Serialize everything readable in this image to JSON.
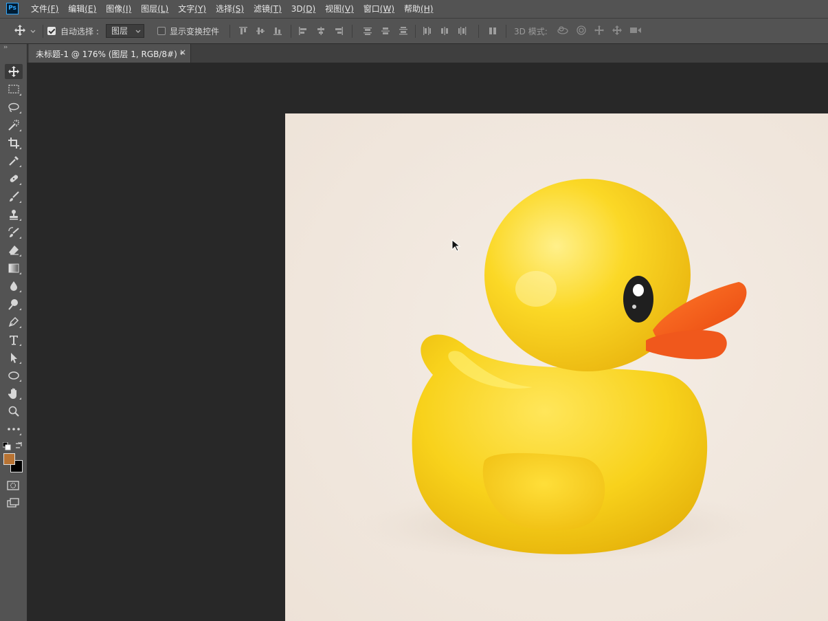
{
  "app": {
    "logo_text": "Ps",
    "menu": [
      {
        "label": "文件",
        "key": "(F)"
      },
      {
        "label": "编辑",
        "key": "(E)"
      },
      {
        "label": "图像",
        "key": "(I)"
      },
      {
        "label": "图层",
        "key": "(L)"
      },
      {
        "label": "文字",
        "key": "(Y)"
      },
      {
        "label": "选择",
        "key": "(S)"
      },
      {
        "label": "滤镜",
        "key": "(T)"
      },
      {
        "label": "3D",
        "key": "(D)"
      },
      {
        "label": "视图",
        "key": "(V)"
      },
      {
        "label": "窗口",
        "key": "(W)"
      },
      {
        "label": "帮助",
        "key": "(H)"
      }
    ]
  },
  "options": {
    "auto_select_label": "自动选择 :",
    "auto_select_checked": true,
    "auto_select_target": "图层",
    "show_transform_label": "显示变换控件",
    "show_transform_checked": false,
    "mode_3d_label": "3D 模式:"
  },
  "document": {
    "tab_title": "未标题-1 @ 176% (图层 1, RGB/8#) *",
    "close_glyph": "×"
  },
  "tools": [
    {
      "name": "move-tool",
      "icon": "move-icon",
      "active": true
    },
    {
      "name": "rect-marquee-tool",
      "icon": "marquee-icon"
    },
    {
      "name": "lasso-tool",
      "icon": "lasso-icon"
    },
    {
      "name": "magic-wand-tool",
      "icon": "magic-wand-icon"
    },
    {
      "name": "crop-tool",
      "icon": "crop-icon"
    },
    {
      "name": "eyedropper-tool",
      "icon": "eyedropper-icon"
    },
    {
      "name": "healing-brush-tool",
      "icon": "bandage-icon"
    },
    {
      "name": "brush-tool",
      "icon": "brush-icon"
    },
    {
      "name": "clone-stamp-tool",
      "icon": "stamp-icon"
    },
    {
      "name": "history-brush-tool",
      "icon": "history-brush-icon"
    },
    {
      "name": "eraser-tool",
      "icon": "eraser-icon"
    },
    {
      "name": "gradient-tool",
      "icon": "gradient-icon"
    },
    {
      "name": "blur-tool",
      "icon": "drop-icon"
    },
    {
      "name": "dodge-tool",
      "icon": "dodge-icon"
    },
    {
      "name": "pen-tool",
      "icon": "pen-icon"
    },
    {
      "name": "type-tool",
      "icon": "type-icon"
    },
    {
      "name": "path-selection-tool",
      "icon": "arrow-icon"
    },
    {
      "name": "ellipse-tool",
      "icon": "ellipse-icon"
    },
    {
      "name": "hand-tool",
      "icon": "hand-icon"
    },
    {
      "name": "zoom-tool",
      "icon": "zoom-icon"
    },
    {
      "name": "edit-toolbar",
      "icon": "more-icon"
    }
  ],
  "colors": {
    "foreground": "#b87333",
    "background": "#000000",
    "canvas_bg": "#f2e9e0",
    "duck_yellow": "#f7d21c",
    "beak_orange": "#f25a1e"
  }
}
